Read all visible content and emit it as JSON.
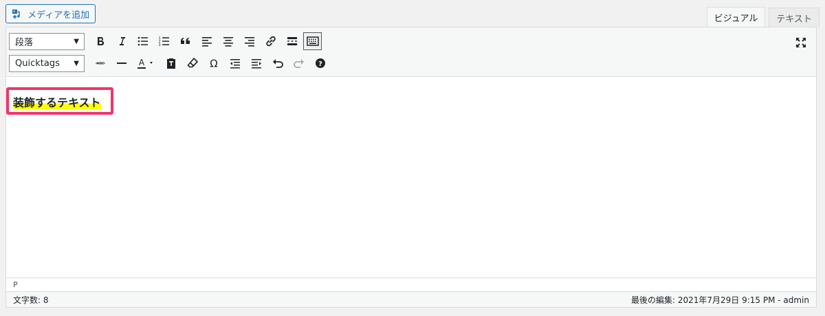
{
  "media_button": {
    "label": "メディアを追加",
    "icon": "add-media-icon"
  },
  "tabs": [
    {
      "label": "ビジュアル",
      "active": true
    },
    {
      "label": "テキスト",
      "active": false
    }
  ],
  "toolbar": {
    "format_select": "段落",
    "style_select": "Quicktags",
    "row1_icons": [
      "bold-icon",
      "italic-icon",
      "bullet-list-icon",
      "numbered-list-icon",
      "blockquote-icon",
      "align-left-icon",
      "align-center-icon",
      "align-right-icon",
      "link-icon",
      "read-more-icon",
      "toolbar-toggle-icon"
    ],
    "row2_icons": [
      "strikethrough-icon",
      "horizontal-line-icon",
      "text-color-icon",
      "paste-text-icon",
      "clear-formatting-icon",
      "special-character-icon",
      "outdent-icon",
      "indent-icon",
      "undo-icon",
      "redo-icon",
      "help-icon"
    ],
    "fullscreen_icon": "fullscreen-icon"
  },
  "content": {
    "text": "装飾するテキスト",
    "highlight_color": "#ffff00",
    "annotation_color": "#f0356b"
  },
  "path_bar": {
    "path": "P"
  },
  "status_bar": {
    "word_count": "文字数: 8",
    "last_edited": "最後の編集: 2021年7月29日 9:15 PM - admin"
  }
}
